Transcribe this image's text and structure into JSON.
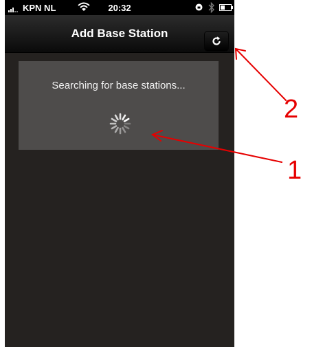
{
  "status_bar": {
    "carrier": "KPN NL",
    "time": "20:32"
  },
  "nav": {
    "title": "Add Base Station",
    "refresh_icon": "refresh-icon"
  },
  "panel": {
    "message": "Searching for base stations...",
    "spinner_icon": "loading-spinner-icon"
  },
  "annotations": {
    "label_1": "1",
    "label_2": "2",
    "color": "#e60000"
  }
}
